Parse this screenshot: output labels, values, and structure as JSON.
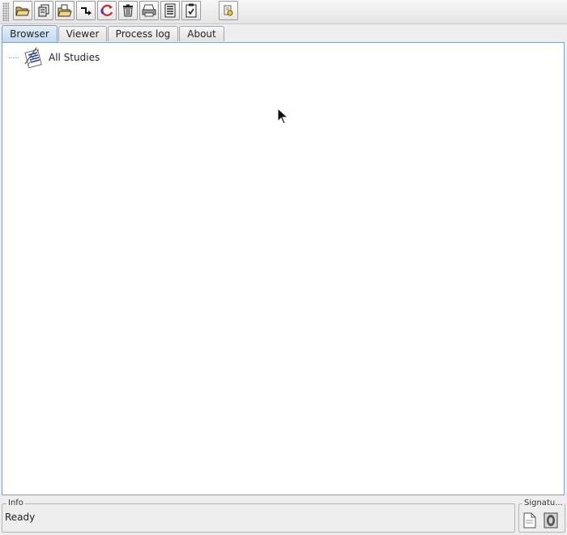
{
  "toolbar": {
    "buttons": [
      {
        "name": "open-folder-icon"
      },
      {
        "name": "copy-icon"
      },
      {
        "name": "import-folder-icon"
      },
      {
        "name": "transfer-arrow-icon"
      },
      {
        "name": "refresh-icon"
      },
      {
        "name": "delete-icon"
      },
      {
        "name": "print-icon"
      },
      {
        "name": "report-icon"
      },
      {
        "name": "clipboard-check-icon"
      },
      {
        "name": "settings-key-icon"
      }
    ]
  },
  "tabs": [
    {
      "label": "Browser",
      "selected": true
    },
    {
      "label": "Viewer",
      "selected": false
    },
    {
      "label": "Process log",
      "selected": false
    },
    {
      "label": "About",
      "selected": false
    }
  ],
  "tree": {
    "root_label": "All Studies",
    "root_icon": "studies-list-icon"
  },
  "info": {
    "legend": "Info",
    "status": "Ready"
  },
  "signature": {
    "legend": "Signatu...",
    "icons": [
      "document-icon",
      "certificate-icon"
    ]
  }
}
